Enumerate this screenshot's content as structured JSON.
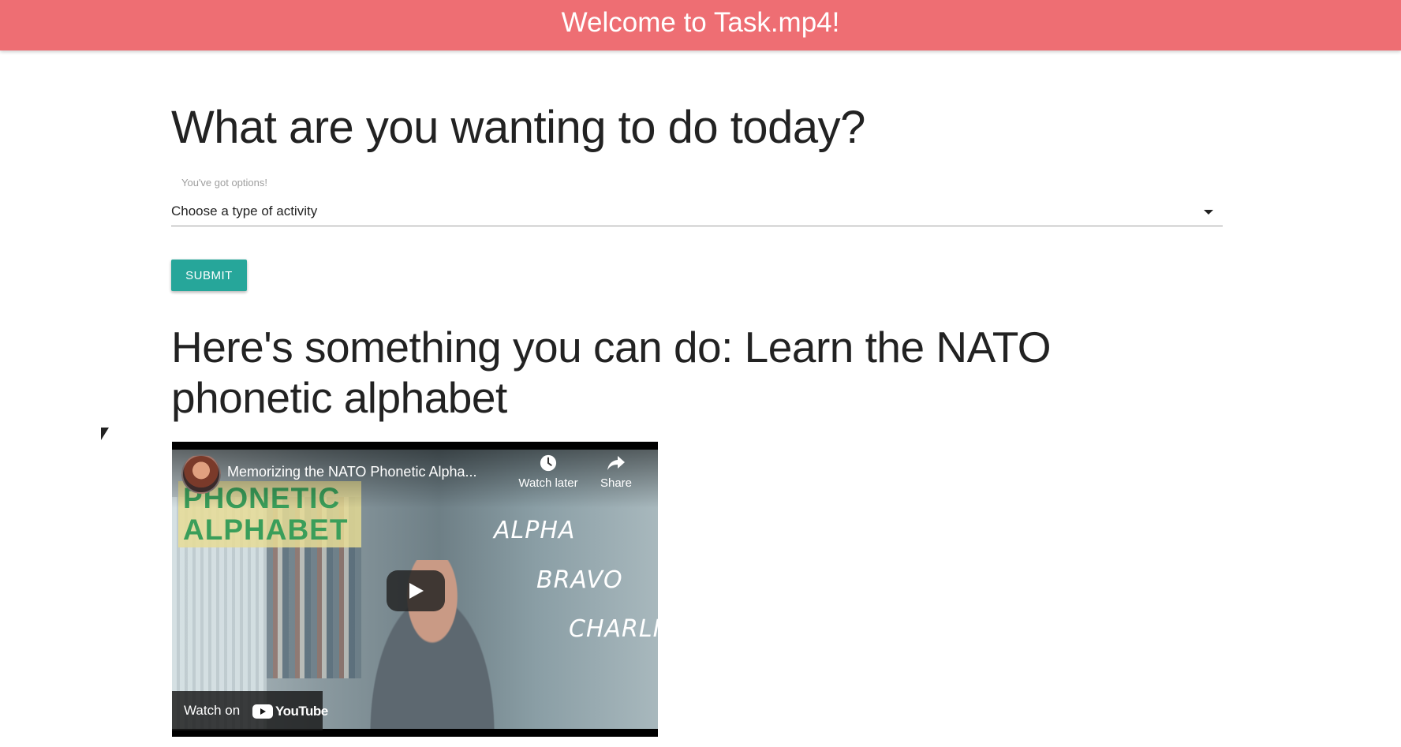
{
  "navbar": {
    "brand": "Welcome to Task.mp4!",
    "color": "#ee6e73"
  },
  "main": {
    "heading": "What are you wanting to do today?",
    "select": {
      "label": "You've got options!",
      "value": "Choose a type of activity",
      "icon": "caret-down-icon"
    },
    "submit_label": "SUBMIT",
    "submit_color": "#26a69a",
    "suggestion": "Here's something you can do: Learn the NATO phonetic alphabet"
  },
  "video": {
    "title": "Memorizing the NATO Phonetic Alpha...",
    "watch_later": "Watch later",
    "share": "Share",
    "watch_on": "Watch on",
    "youtube": "YouTube",
    "thumbnail_title": "PHONETIC ALPHABET",
    "thumbnail_words": [
      "ALPHA",
      "BRAVO",
      "CHARLIE"
    ]
  }
}
